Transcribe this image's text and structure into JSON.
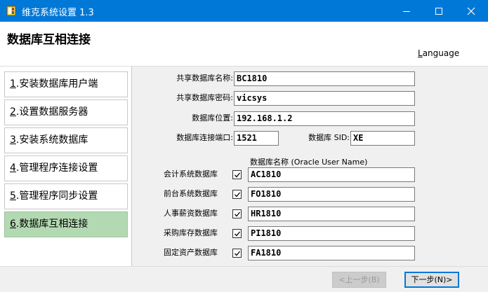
{
  "window": {
    "title": "维克系统设置 1.3",
    "titlebar_color": "#0078d7"
  },
  "header": {
    "page_title": "数据库互相连接",
    "language_first": "L",
    "language_rest": "anguage"
  },
  "sidebar": {
    "active_color": "#b3d9b3",
    "steps": [
      {
        "num": "1",
        "label": ".安装数据库用户端"
      },
      {
        "num": "2",
        "label": ".设置数据服务器"
      },
      {
        "num": "3",
        "label": ".安装系统数据库"
      },
      {
        "num": "4",
        "label": ".管理程序连接设置"
      },
      {
        "num": "5",
        "label": ".管理程序同步设置"
      },
      {
        "num": "6",
        "label": ".数据库互相连接"
      }
    ]
  },
  "form": {
    "shared_db_name": {
      "label": "共享数据库名称:",
      "value": "BC1810"
    },
    "shared_db_password": {
      "label": "共享数据库密码:",
      "value": "vicsys"
    },
    "db_location": {
      "label": "数据库位置:",
      "value": "192.168.1.2"
    },
    "db_port": {
      "label": "数据库连接端口:",
      "value": "1521"
    },
    "db_sid": {
      "label": "数据库 SID:",
      "value": "XE"
    }
  },
  "databases": {
    "column_header": "数据库名称 (Oracle User Name)",
    "rows": [
      {
        "label": "会计系统数据库",
        "checked": true,
        "value": "AC1810"
      },
      {
        "label": "前台系统数据库",
        "checked": true,
        "value": "FO1810"
      },
      {
        "label": "人事薪资数据库",
        "checked": true,
        "value": "HR1810"
      },
      {
        "label": "采购库存数据库",
        "checked": true,
        "value": "PI1810"
      },
      {
        "label": "固定资产数据库",
        "checked": true,
        "value": "FA1810"
      }
    ]
  },
  "footer": {
    "prev_label": "<上一步(B)",
    "next_label": "下一步(N)>"
  }
}
